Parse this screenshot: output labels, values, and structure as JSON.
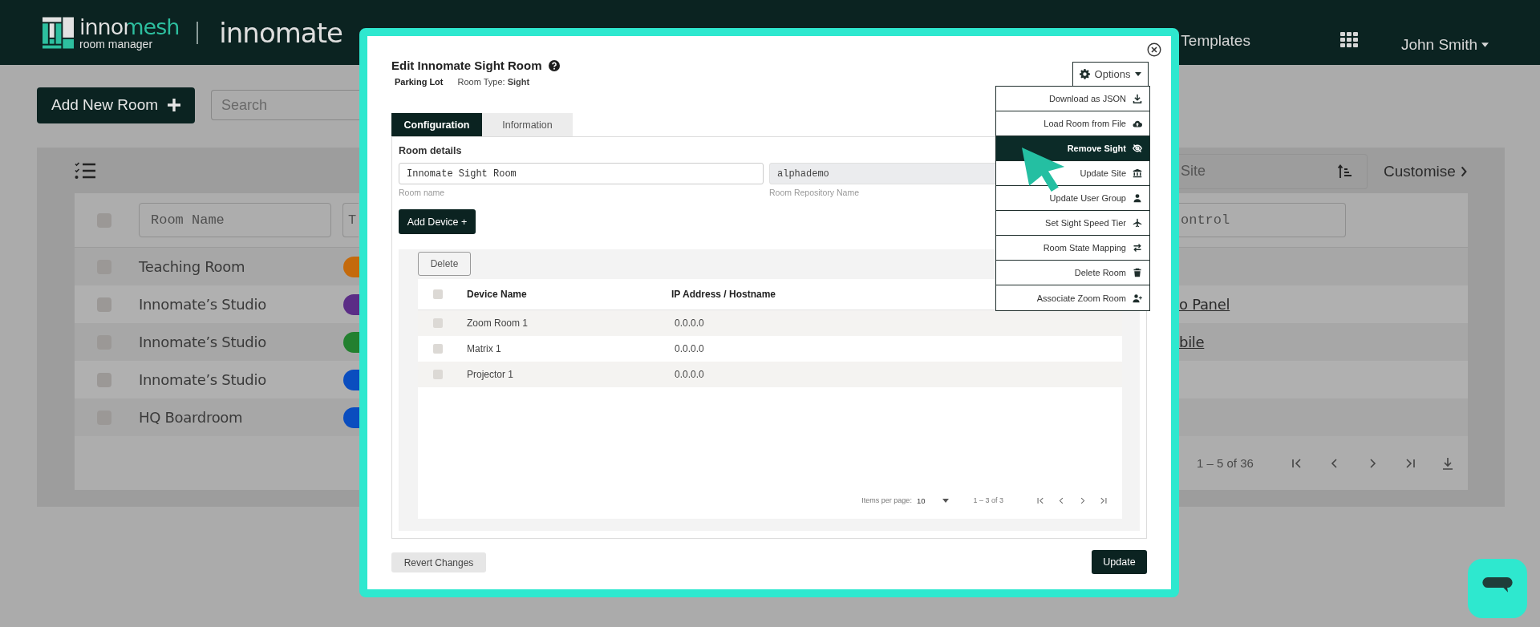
{
  "header": {
    "brand": "innomesh",
    "brand_sub": "room manager",
    "partner": "innomate",
    "nav": [
      {
        "label": "Templates"
      }
    ],
    "user": "John Smith"
  },
  "toolbar": {
    "add_button": "Add New Room",
    "search": {
      "placeholder": "Search"
    }
  },
  "rooms": {
    "select_all_checked": false,
    "filters_left": [
      {
        "placeholder": "Room Name"
      },
      {
        "placeholder": "T"
      }
    ],
    "sort_field": {
      "placeholder": "Site"
    },
    "customise": "Customise",
    "filter_right": {
      "placeholder": "ontrol"
    },
    "rows": [
      {
        "name": "Teaching Room",
        "color": "#c46a0c",
        "checked": false
      },
      {
        "name": "Innomate’s Studio",
        "color": "#5b2d86",
        "checked": false,
        "link": "o Panel"
      },
      {
        "name": "Innomate’s Studio",
        "color": "#23802f",
        "checked": false,
        "link": "bile"
      },
      {
        "name": "Innomate’s Studio",
        "color": "#0a4dbf",
        "checked": false
      },
      {
        "name": "HQ Boardroom",
        "color": "#0a4dbf",
        "checked": false
      }
    ],
    "range": "1 – 5 of 36"
  },
  "modal": {
    "title": "Edit Innomate Sight Room",
    "site": "Parking Lot",
    "room_type": "Room Type: **Sight**",
    "options": "Options",
    "menu": [
      {
        "label": "Download as JSON",
        "selected": false
      },
      {
        "label": "Load Room from File",
        "selected": false
      },
      {
        "label": "Remove Sight",
        "selected": true
      },
      {
        "label": "Update Site",
        "selected": false
      },
      {
        "label": "Update User Group",
        "selected": false
      },
      {
        "label": "Set Sight Speed Tier",
        "selected": false
      },
      {
        "label": "Room State Mapping",
        "selected": false
      },
      {
        "label": "Delete Room",
        "selected": false
      },
      {
        "label": "Associate Zoom Room",
        "selected": false
      }
    ],
    "tabs": [
      {
        "label": "Configuration",
        "selected": true
      },
      {
        "label": "Information",
        "selected": false
      }
    ],
    "section": "Room details",
    "fields": [
      {
        "value": "Innomate Sight Room",
        "label": "Room name",
        "disabled": false
      },
      {
        "value": "alphademo",
        "label": "Room Repository Name",
        "disabled": true
      }
    ],
    "add_device": "Add Device +",
    "delete": "Delete",
    "devices": {
      "all_checked": false,
      "columns": [
        "Device Name",
        "IP Address / Hostname"
      ],
      "rows": [
        {
          "name": "Zoom Room 1",
          "address": "0.0.0.0",
          "checked": false
        },
        {
          "name": "Matrix 1",
          "address": "0.0.0.0",
          "checked": false
        },
        {
          "name": "Projector 1",
          "address": "0.0.0.0",
          "checked": false
        }
      ],
      "items_per_page_label": "Items per page:",
      "page_size": "10",
      "range": "1 – 3 of 3"
    },
    "revert": "Revert Changes",
    "update": "Update"
  }
}
